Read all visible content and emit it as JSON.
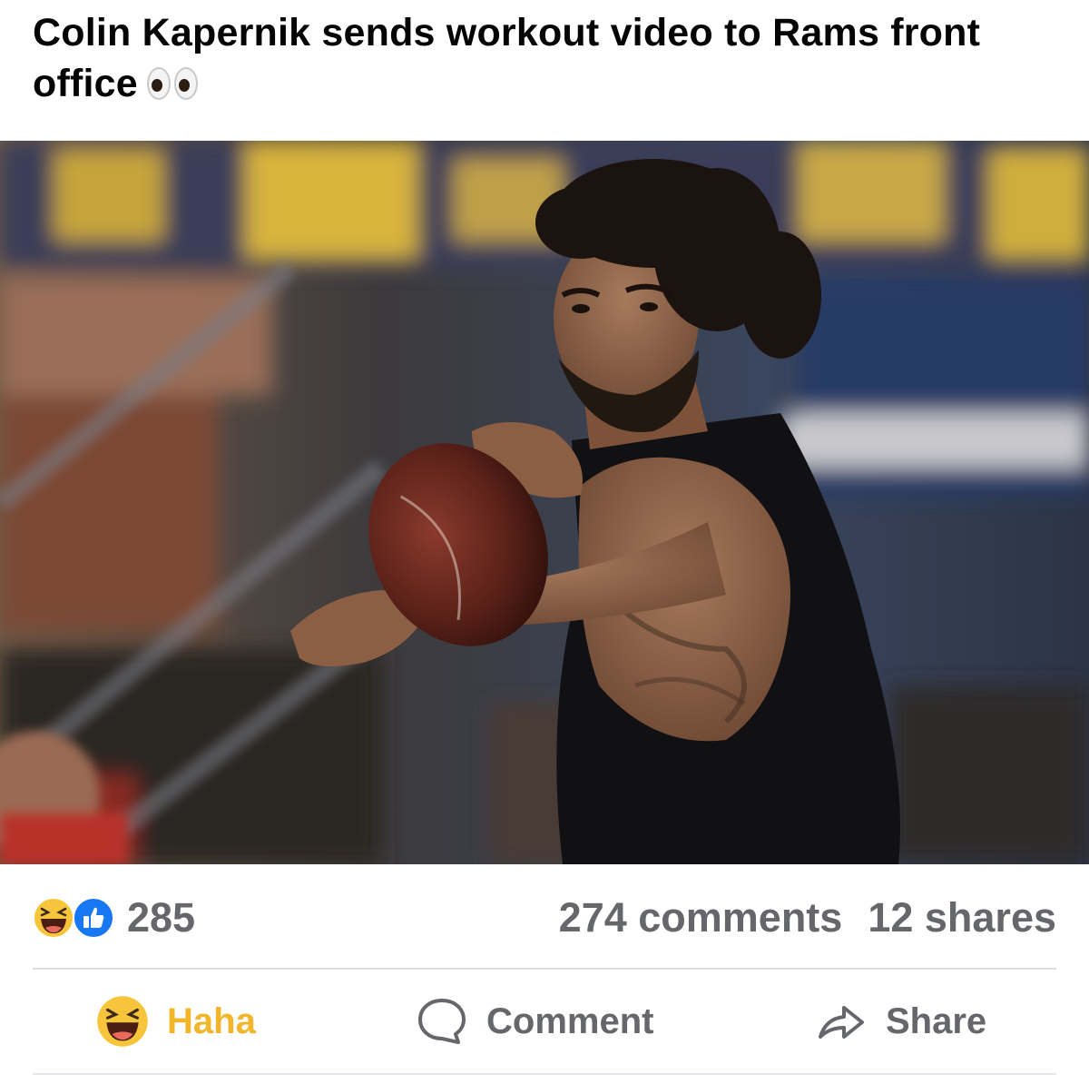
{
  "post": {
    "title": "Colin Kapernik sends workout video to Rams front office",
    "title_emoji": "eyes-emoji",
    "photo_subject": "football-player-throwing-icon"
  },
  "stats": {
    "reaction_count": "285",
    "comments": "274 comments",
    "shares": "12 shares",
    "reactions": [
      "haha-icon",
      "like-icon"
    ]
  },
  "actions": {
    "haha_label": "Haha",
    "comment_label": "Comment",
    "share_label": "Share"
  },
  "colors": {
    "haha_accent": "#f3b529",
    "like_blue": "#1877f2",
    "muted_text": "#65676b",
    "title_text": "#050505"
  }
}
